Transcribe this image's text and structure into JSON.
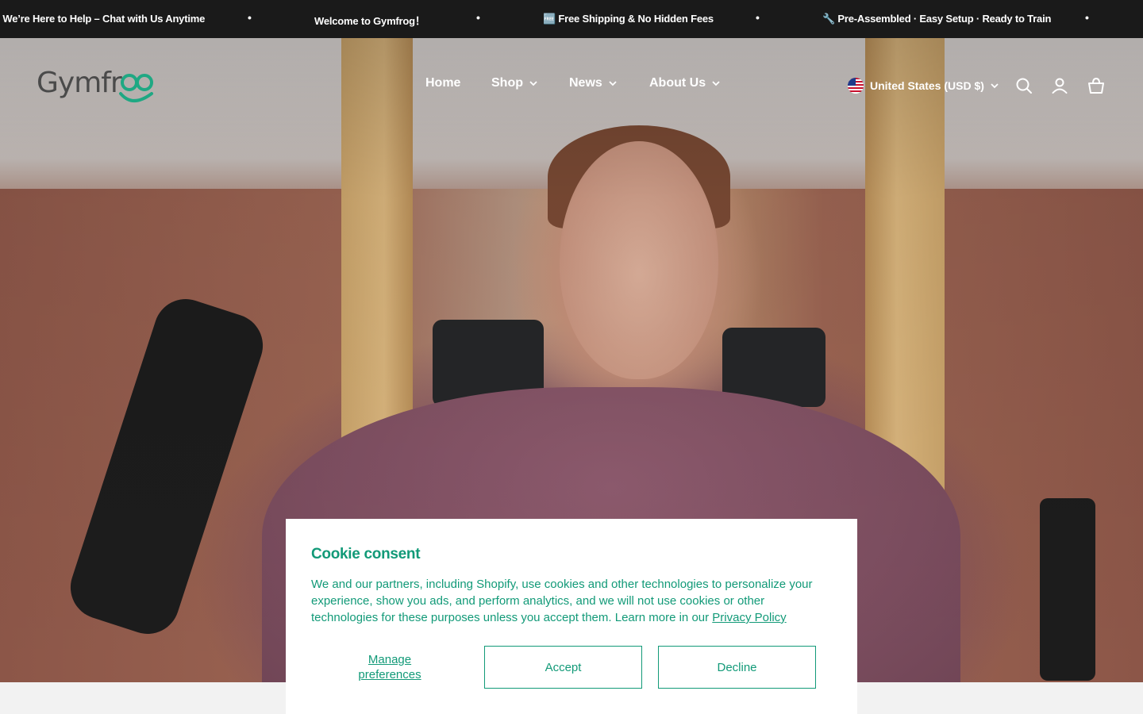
{
  "announcement": {
    "messages": [
      "💬 We’re Here to Help – Chat with Us Anytime",
      "Welcome to Gymfrog！",
      "🆓 Free Shipping & No Hidden Fees",
      "🔧 Pre-Assembled · Easy Setup · Ready to Train"
    ],
    "separator": "•"
  },
  "header": {
    "logo_text": "Gymfrog",
    "nav": [
      {
        "label": "Home",
        "has_dropdown": false
      },
      {
        "label": "Shop",
        "has_dropdown": true
      },
      {
        "label": "News",
        "has_dropdown": true
      },
      {
        "label": "About Us",
        "has_dropdown": true
      }
    ],
    "country_selector": "United States (USD $)",
    "icons": [
      "search-icon",
      "account-icon",
      "cart-icon"
    ]
  },
  "cookie_consent": {
    "title": "Cookie consent",
    "body": "We and our partners, including Shopify, use cookies and other technologies to personalize your experience, show you ads, and perform analytics, and we will not use cookies or other technologies for these purposes unless you accept them. Learn more in our ",
    "privacy_link": "Privacy Policy",
    "manage_label": "Manage preferences",
    "accept_label": "Accept",
    "decline_label": "Decline"
  },
  "colors": {
    "announcement_bg": "#1a1a1a",
    "brand_green": "#129a78",
    "logo_gray": "#4a4a4a"
  }
}
